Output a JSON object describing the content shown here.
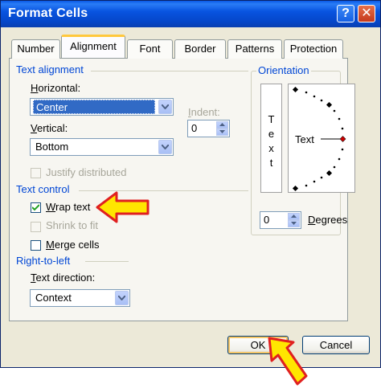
{
  "window": {
    "title": "Format Cells",
    "help_label": "?",
    "close_label": "✕"
  },
  "tabs": [
    {
      "label": "Number"
    },
    {
      "label": "Alignment"
    },
    {
      "label": "Font"
    },
    {
      "label": "Border"
    },
    {
      "label": "Patterns"
    },
    {
      "label": "Protection"
    }
  ],
  "active_tab": "Alignment",
  "text_alignment": {
    "section_label": "Text alignment",
    "horizontal_label_u": "H",
    "horizontal_label_rest": "orizontal:",
    "horizontal_value": "Center",
    "vertical_label_u": "V",
    "vertical_label_rest": "ertical:",
    "vertical_value": "Bottom",
    "indent_label_u": "I",
    "indent_label_rest": "ndent:",
    "indent_value": "0",
    "justify_label": "Justify distributed"
  },
  "text_control": {
    "section_label": "Text control",
    "wrap_u": "W",
    "wrap_rest": "rap text",
    "wrap_checked": true,
    "shrink_label": "Shrink to fit",
    "merge_u": "M",
    "merge_rest": "erge cells",
    "merge_checked": false
  },
  "right_to_left": {
    "section_label": "Right-to-left",
    "direction_label_u": "T",
    "direction_label_rest": "ext direction:",
    "direction_value": "Context"
  },
  "orientation": {
    "section_label": "Orientation",
    "vertical_letters": [
      "T",
      "e",
      "x",
      "t"
    ],
    "dial_text": "Text",
    "degrees_value": "0",
    "degrees_label_u": "D",
    "degrees_label_rest": "egrees"
  },
  "buttons": {
    "ok": "OK",
    "cancel": "Cancel"
  },
  "colors": {
    "section": "#0046d5",
    "arrow_fill": "#ffe600",
    "arrow_stroke": "#e02020",
    "titlebar": "#0854e0"
  }
}
